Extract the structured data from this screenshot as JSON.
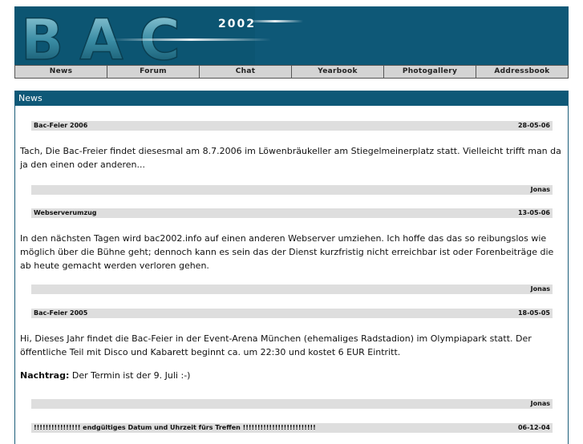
{
  "banner": {
    "logo_text": "BAC",
    "year_text": "2002"
  },
  "nav": {
    "items": [
      {
        "label": "News"
      },
      {
        "label": "Forum"
      },
      {
        "label": "Chat"
      },
      {
        "label": "Yearbook"
      },
      {
        "label": "Photogallery"
      },
      {
        "label": "Addressbook"
      }
    ]
  },
  "news": {
    "title": "News",
    "posts": [
      {
        "title": "Bac-Feier 2006",
        "date": "28-05-06",
        "text": "Tach, Die Bac-Freier findet diesesmal am 8.7.2006 im Löwenbräukeller am Stiegelmeinerplatz statt. Vielleicht trifft man da ja den einen oder anderen...",
        "author": "Jonas"
      },
      {
        "title": "Webserverumzug",
        "date": "13-05-06",
        "text": "In den nächsten Tagen wird bac2002.info auf einen anderen Webserver umziehen. Ich hoffe das das so reibungslos wie möglich über die Bühne geht; dennoch kann es sein das der Dienst kurzfristig nicht erreichbar ist oder Forenbeiträge die ab heute gemacht werden verloren gehen.",
        "author": "Jonas"
      },
      {
        "title": "Bac-Feier 2005",
        "date": "18-05-05",
        "text": "Hi, Dieses Jahr findet die Bac-Feier in der Event-Arena München (ehemaliges Radstadion) im Olympiapark statt. Der öffentliche Teil mit Disco und Kabarett beginnt ca. um 22:30 und kostet 6 EUR Eintritt.",
        "addendum_label": "Nachtrag:",
        "addendum_text": " Der Termin ist der 9. Juli :-)",
        "author": "Jonas"
      },
      {
        "title": "!!!!!!!!!!!!!!!! endgültiges Datum und Uhrzeit fürs Treffen !!!!!!!!!!!!!!!!!!!!!!!!!",
        "date": "06-12-04"
      }
    ]
  },
  "colors": {
    "brand": "#0e5877",
    "bar": "#dedede"
  }
}
